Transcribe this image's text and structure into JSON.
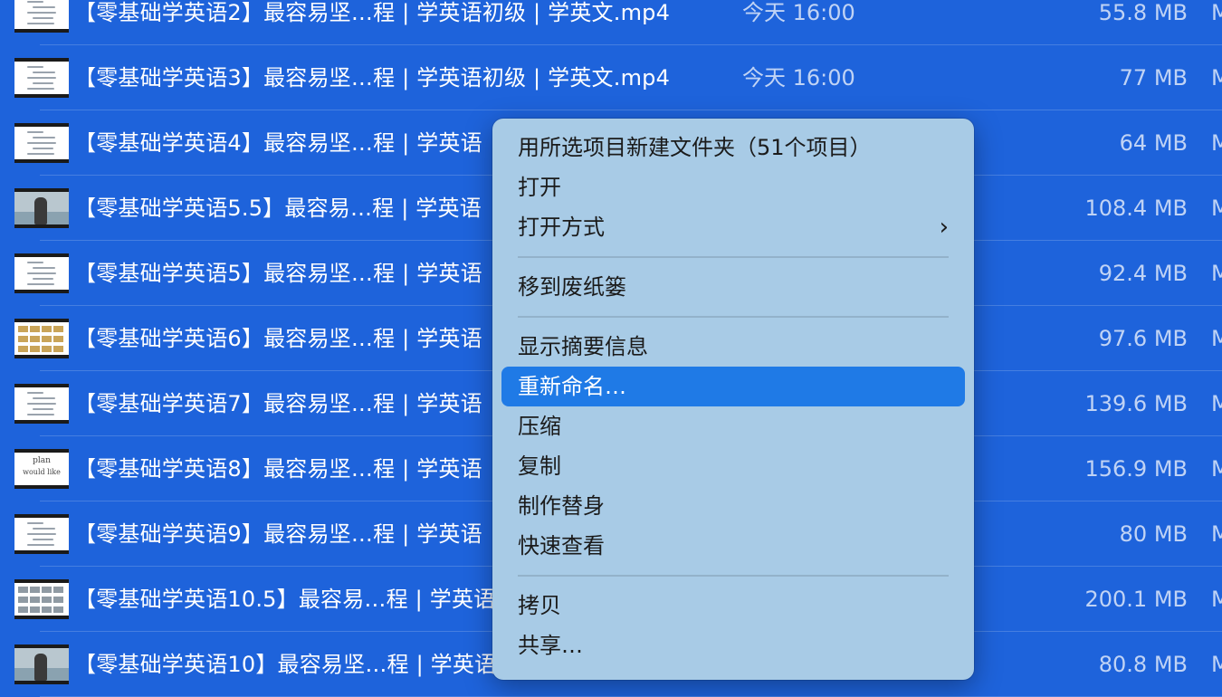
{
  "files": [
    {
      "name": "【零基础学英语2】最容易坚…程 | 学英语初级 | 学英文.mp4",
      "date": "今天 16:00",
      "size": "55.8 MB",
      "kind": "M",
      "thumb": "text"
    },
    {
      "name": "【零基础学英语3】最容易坚…程 | 学英语初级 | 学英文.mp4",
      "date": "今天 16:00",
      "size": "77 MB",
      "kind": "M",
      "thumb": "text"
    },
    {
      "name": "【零基础学英语4】最容易坚…程 | 学英语",
      "date": "",
      "size": "64 MB",
      "kind": "M",
      "thumb": "text"
    },
    {
      "name": "【零基础学英语5.5】最容易…程 | 学英语",
      "date": "",
      "size": "108.4 MB",
      "kind": "M",
      "thumb": "photo"
    },
    {
      "name": "【零基础学英语5】最容易坚…程 | 学英语",
      "date": "",
      "size": "92.4 MB",
      "kind": "M",
      "thumb": "text"
    },
    {
      "name": "【零基础学英语6】最容易坚…程 | 学英语",
      "date": "",
      "size": "97.6 MB",
      "kind": "M",
      "thumb": "strip"
    },
    {
      "name": "【零基础学英语7】最容易坚…程 | 学英语",
      "date": "",
      "size": "139.6 MB",
      "kind": "M",
      "thumb": "text"
    },
    {
      "name": "【零基础学英语8】最容易坚…程 | 学英语",
      "date": "",
      "size": "156.9 MB",
      "kind": "M",
      "thumb": "plan"
    },
    {
      "name": "【零基础学英语9】最容易坚…程 | 学英语",
      "date": "",
      "size": "80 MB",
      "kind": "M",
      "thumb": "text"
    },
    {
      "name": "【零基础学英语10.5】最容易…程 | 学英语",
      "date": "",
      "size": "200.1 MB",
      "kind": "M",
      "thumb": "strip2"
    },
    {
      "name": "【零基础学英语10】最容易坚…程 | 学英语",
      "date": "",
      "size": "80.8 MB",
      "kind": "M",
      "thumb": "photo"
    }
  ],
  "thumb_text": {
    "plan_line1": "plan",
    "plan_line2": "would like"
  },
  "context_menu": {
    "groups": [
      [
        {
          "label": "用所选项目新建文件夹（51个项目）",
          "submenu": false,
          "highlighted": false
        },
        {
          "label": "打开",
          "submenu": false,
          "highlighted": false
        },
        {
          "label": "打开方式",
          "submenu": true,
          "highlighted": false
        }
      ],
      [
        {
          "label": "移到废纸篓",
          "submenu": false,
          "highlighted": false
        }
      ],
      [
        {
          "label": "显示摘要信息",
          "submenu": false,
          "highlighted": false
        },
        {
          "label": "重新命名…",
          "submenu": false,
          "highlighted": true
        },
        {
          "label": "压缩",
          "submenu": false,
          "highlighted": false
        },
        {
          "label": "复制",
          "submenu": false,
          "highlighted": false
        },
        {
          "label": "制作替身",
          "submenu": false,
          "highlighted": false
        },
        {
          "label": "快速查看",
          "submenu": false,
          "highlighted": false
        }
      ],
      [
        {
          "label": "拷贝",
          "submenu": false,
          "highlighted": false
        },
        {
          "label": "共享…",
          "submenu": false,
          "highlighted": false
        }
      ]
    ],
    "chevron_icon": "›"
  },
  "colors": {
    "selection_bg": "#1e63db",
    "menu_bg": "#a8cbe6",
    "highlight": "#1f7ae6"
  }
}
